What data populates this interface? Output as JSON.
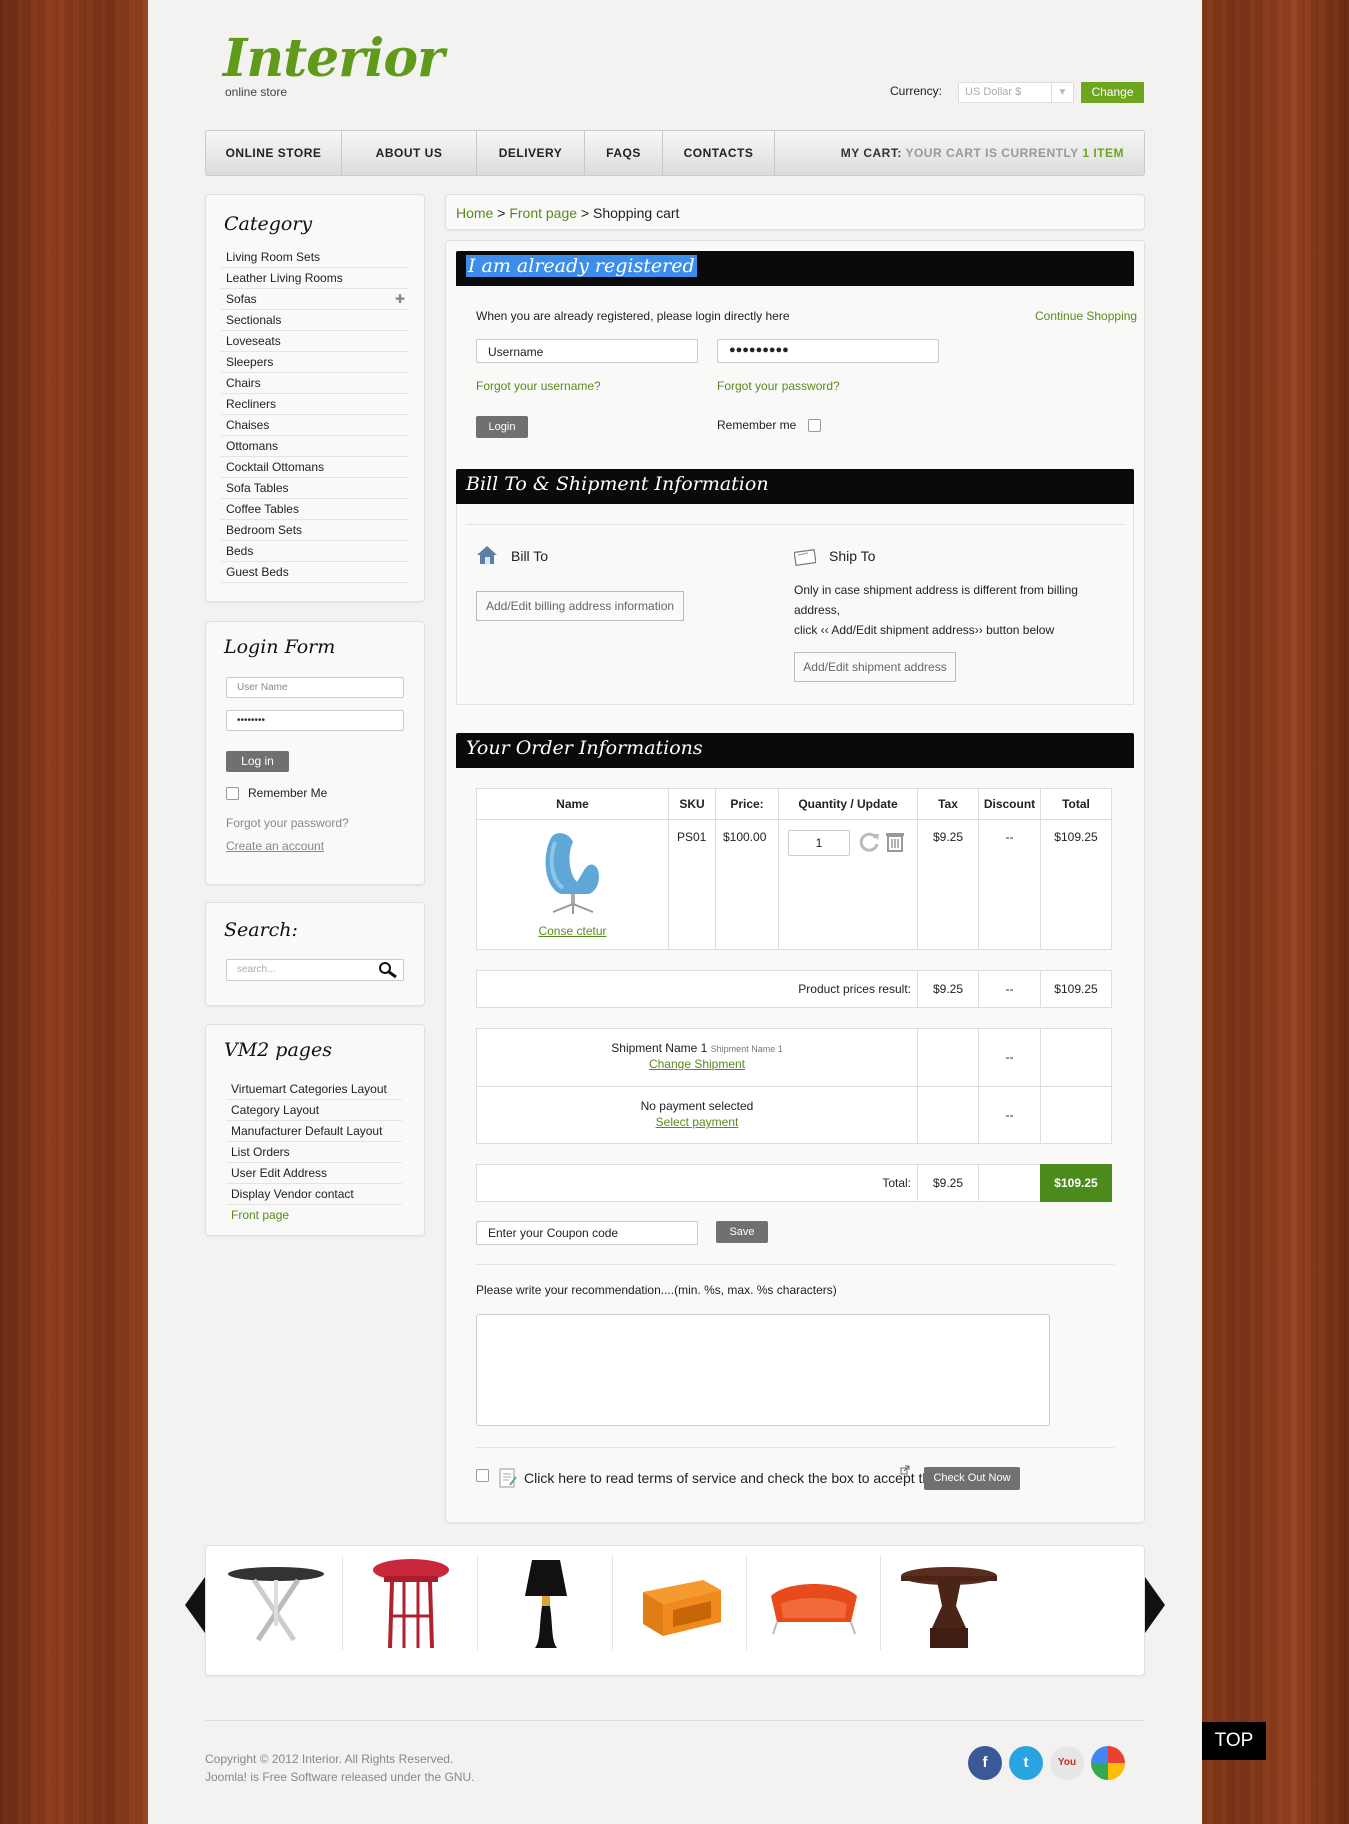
{
  "header": {
    "logo": "Interior",
    "logo_sub": "online store",
    "currency_label": "Currency:",
    "currency_value": "US Dollar $",
    "change_button": "Change"
  },
  "nav": {
    "items": [
      "ONLINE STORE",
      "ABOUT US",
      "DELIVERY",
      "FAQS",
      "CONTACTS"
    ],
    "cart_label": "MY CART:",
    "cart_text": "YOUR CART IS CURRENTLY",
    "cart_count": "1 ITEM"
  },
  "sidebar": {
    "category_title": "Category",
    "categories": [
      "Living Room Sets",
      "Leather Living Rooms",
      "Sofas",
      "Sectionals",
      "Loveseats",
      "Sleepers",
      "Chairs",
      "Recliners",
      "Chaises",
      "Ottomans",
      "Cocktail Ottomans",
      "Sofa Tables",
      "Coffee Tables",
      "Bedroom Sets",
      "Beds",
      "Guest Beds"
    ],
    "login_title": "Login Form",
    "login_user_placeholder": "User Name",
    "login_pass_value": "••••••••",
    "login_button": "Log in",
    "remember_me": "Remember Me",
    "forgot_password": "Forgot your password?",
    "create_account": "Create an account",
    "search_title": "Search:",
    "search_placeholder": "search...",
    "vm_title": "VM2 pages",
    "vm_pages": [
      "Virtuemart Categories Layout",
      "Category Layout",
      "Manufacturer Default Layout",
      "List Orders",
      "User Edit Address",
      "Display Vendor contact",
      "Front page"
    ]
  },
  "breadcrumb": {
    "home": "Home",
    "sep1": ">",
    "front": "Front page",
    "sep2": ">",
    "current": "Shopping cart"
  },
  "registered": {
    "title": "I am already registered",
    "intro": "When you are already registered, please login directly here",
    "continue": "Continue Shopping",
    "username_value": "Username",
    "password_value": "●●●●●●●●●",
    "forgot_username": "Forgot your username?",
    "forgot_password": "Forgot your password?",
    "login_button": "Login",
    "remember_me": "Remember me"
  },
  "billship": {
    "title": "Bill To & Shipment Information",
    "bill_to": "Bill To",
    "bill_button": "Add/Edit billing address information",
    "ship_to": "Ship To",
    "ship_note_1": "Only in case shipment address is different from billing",
    "ship_note_2": "address,",
    "ship_note_3": "click ‹‹ Add/Edit shipment address›› button below",
    "ship_button": "Add/Edit shipment address"
  },
  "order": {
    "title": "Your Order Informations",
    "headers": [
      "Name",
      "SKU",
      "Price:",
      "Quantity / Update",
      "Tax",
      "Discount",
      "Total"
    ],
    "product_name": "Conse ctetur",
    "sku": "PS01",
    "price": "$100.00",
    "quantity": "1",
    "tax": "$9.25",
    "discount": "--",
    "total": "$109.25",
    "subtotal_label": "Product prices result:",
    "subtotal_tax": "$9.25",
    "subtotal_discount": "--",
    "subtotal_total": "$109.25",
    "shipment_name": "Shipment Name 1",
    "shipment_small": "Shipment Name 1",
    "change_shipment": "Change Shipment",
    "shipment_discount": "--",
    "no_payment": "No payment selected",
    "select_payment": "Select payment",
    "payment_discount": "--",
    "grand_label": "Total:",
    "grand_tax": "$9.25",
    "grand_total": "$109.25",
    "coupon_value": "Enter your Coupon code",
    "coupon_save": "Save",
    "recommendation": "Please write your recommendation....(min. %s, max. %s characters)",
    "terms": "Click here to read terms of service and check the box to accept them.",
    "checkout": "Check Out Now"
  },
  "footer": {
    "copyright_1": "Copyright © 2012 Interior. All Rights Reserved.",
    "copyright_2": "Joomla! is Free Software released under the GNU.",
    "top": "TOP"
  },
  "colors": {
    "accent": "#6ea51f",
    "header_bar": "#0a0a0a",
    "selection": "#3d8eea"
  }
}
